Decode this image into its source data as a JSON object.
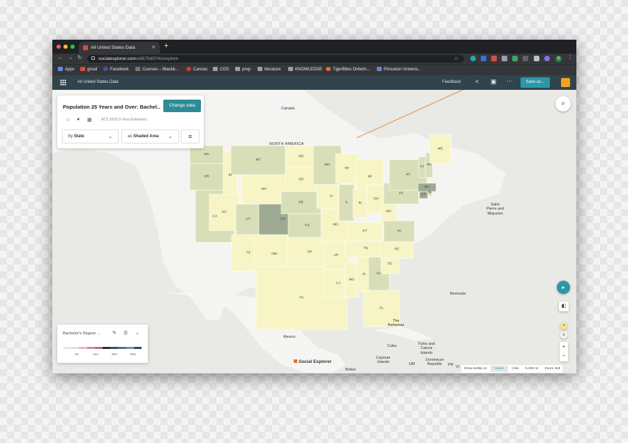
{
  "browser": {
    "tab_title": "All United States Data",
    "url_domain": "socialexplorer.com",
    "url_path": "/a9676d974c/explore",
    "bookmarks": [
      "Apps",
      "gmail",
      "Facebook",
      "Courses – Blackb...",
      "Canvas",
      "COS",
      "prep",
      "literature",
      "KNOWLEDGE",
      "TigerBites Orderin...",
      "Princeton Universi..."
    ],
    "profile_initial": "S"
  },
  "app": {
    "title": "All United States Data",
    "feedback": "Feedback",
    "save_as": "Save as..."
  },
  "panel": {
    "title": "Population 25 Years and Over: Bachel...",
    "change_data": "Change data",
    "survey": "ACS 2018 (5-Year Estimates)",
    "by_prefix": "by",
    "by_value": "State",
    "as_prefix": "as",
    "as_value": "Shaded Area"
  },
  "legend": {
    "title": "Bachelor's Degree ...",
    "ticks": [
      "1%",
      "13%",
      "40%",
      "90%"
    ],
    "colors": [
      "#e6e6e6",
      "#f2dadd",
      "#e7b9c0",
      "#c79098",
      "#a7747c",
      "#2b2b3a",
      "#3c4b62",
      "#55708a",
      "#6f92ad",
      "#2c4a6a"
    ]
  },
  "map_labels": {
    "canada": "Canada",
    "north_america": "NORTH AMERICA",
    "saint_pierre": "Saint\nPierre and\nMiquelon",
    "bermuda": "Bermuda",
    "the_bahamas": "The\nBahamas",
    "mexico": "Mexico",
    "cuba": "Cuba",
    "turks": "Turks and\nCaicos\nIslands",
    "cayman": "Cayman\nIslands",
    "dominican": "Dominican\nRepublic",
    "belize": "Belize",
    "um": "UM",
    "pr": "PR",
    "vi": "VI"
  },
  "states": [
    {
      "abbr": "WA",
      "shade": 2
    },
    {
      "abbr": "OR",
      "shade": 2
    },
    {
      "abbr": "CA",
      "shade": 2
    },
    {
      "abbr": "ID",
      "shade": 1
    },
    {
      "abbr": "NV",
      "shade": 1
    },
    {
      "abbr": "MT",
      "shade": 2
    },
    {
      "abbr": "WY",
      "shade": 1
    },
    {
      "abbr": "UT",
      "shade": 2
    },
    {
      "abbr": "AZ",
      "shade": 1
    },
    {
      "abbr": "CO",
      "shade": 3
    },
    {
      "abbr": "NM",
      "shade": 1
    },
    {
      "abbr": "ND",
      "shade": 1
    },
    {
      "abbr": "SD",
      "shade": 1
    },
    {
      "abbr": "NE",
      "shade": 2
    },
    {
      "abbr": "KS",
      "shade": 2
    },
    {
      "abbr": "OK",
      "shade": 1
    },
    {
      "abbr": "TX",
      "shade": 1
    },
    {
      "abbr": "MN",
      "shade": 2
    },
    {
      "abbr": "IA",
      "shade": 1
    },
    {
      "abbr": "MO",
      "shade": 1
    },
    {
      "abbr": "AR",
      "shade": 1
    },
    {
      "abbr": "LA",
      "shade": 1
    },
    {
      "abbr": "WI",
      "shade": 1
    },
    {
      "abbr": "IL",
      "shade": 2
    },
    {
      "abbr": "MS",
      "shade": 1
    },
    {
      "abbr": "MI",
      "shade": 1
    },
    {
      "abbr": "IN",
      "shade": 1
    },
    {
      "abbr": "KY",
      "shade": 1
    },
    {
      "abbr": "TN",
      "shade": 1
    },
    {
      "abbr": "AL",
      "shade": 1
    },
    {
      "abbr": "OH",
      "shade": 1
    },
    {
      "abbr": "WV",
      "shade": 1
    },
    {
      "abbr": "GA",
      "shade": 2
    },
    {
      "abbr": "FL",
      "shade": 1
    },
    {
      "abbr": "SC",
      "shade": 1
    },
    {
      "abbr": "NC",
      "shade": 1
    },
    {
      "abbr": "VA",
      "shade": 2
    },
    {
      "abbr": "PA",
      "shade": 2
    },
    {
      "abbr": "NY",
      "shade": 2
    },
    {
      "abbr": "VT",
      "shade": 2
    },
    {
      "abbr": "NH",
      "shade": 2
    },
    {
      "abbr": "ME",
      "shade": 1
    },
    {
      "abbr": "CT",
      "shade": 3
    },
    {
      "abbr": "RI",
      "shade": 2
    },
    {
      "abbr": "MA",
      "shade": 3
    }
  ],
  "shade_colors": [
    "#e9e9e5",
    "#f7f4c6",
    "#d8dfb8",
    "#9eab92"
  ],
  "footer": {
    "logo": "Social Explorer",
    "show_tooltip": "Show tooltip on",
    "hover": "Hover",
    "click": "Click",
    "scale": "5,260 mi",
    "zoom_label": "Zoom:",
    "zoom_value": "3.3"
  }
}
